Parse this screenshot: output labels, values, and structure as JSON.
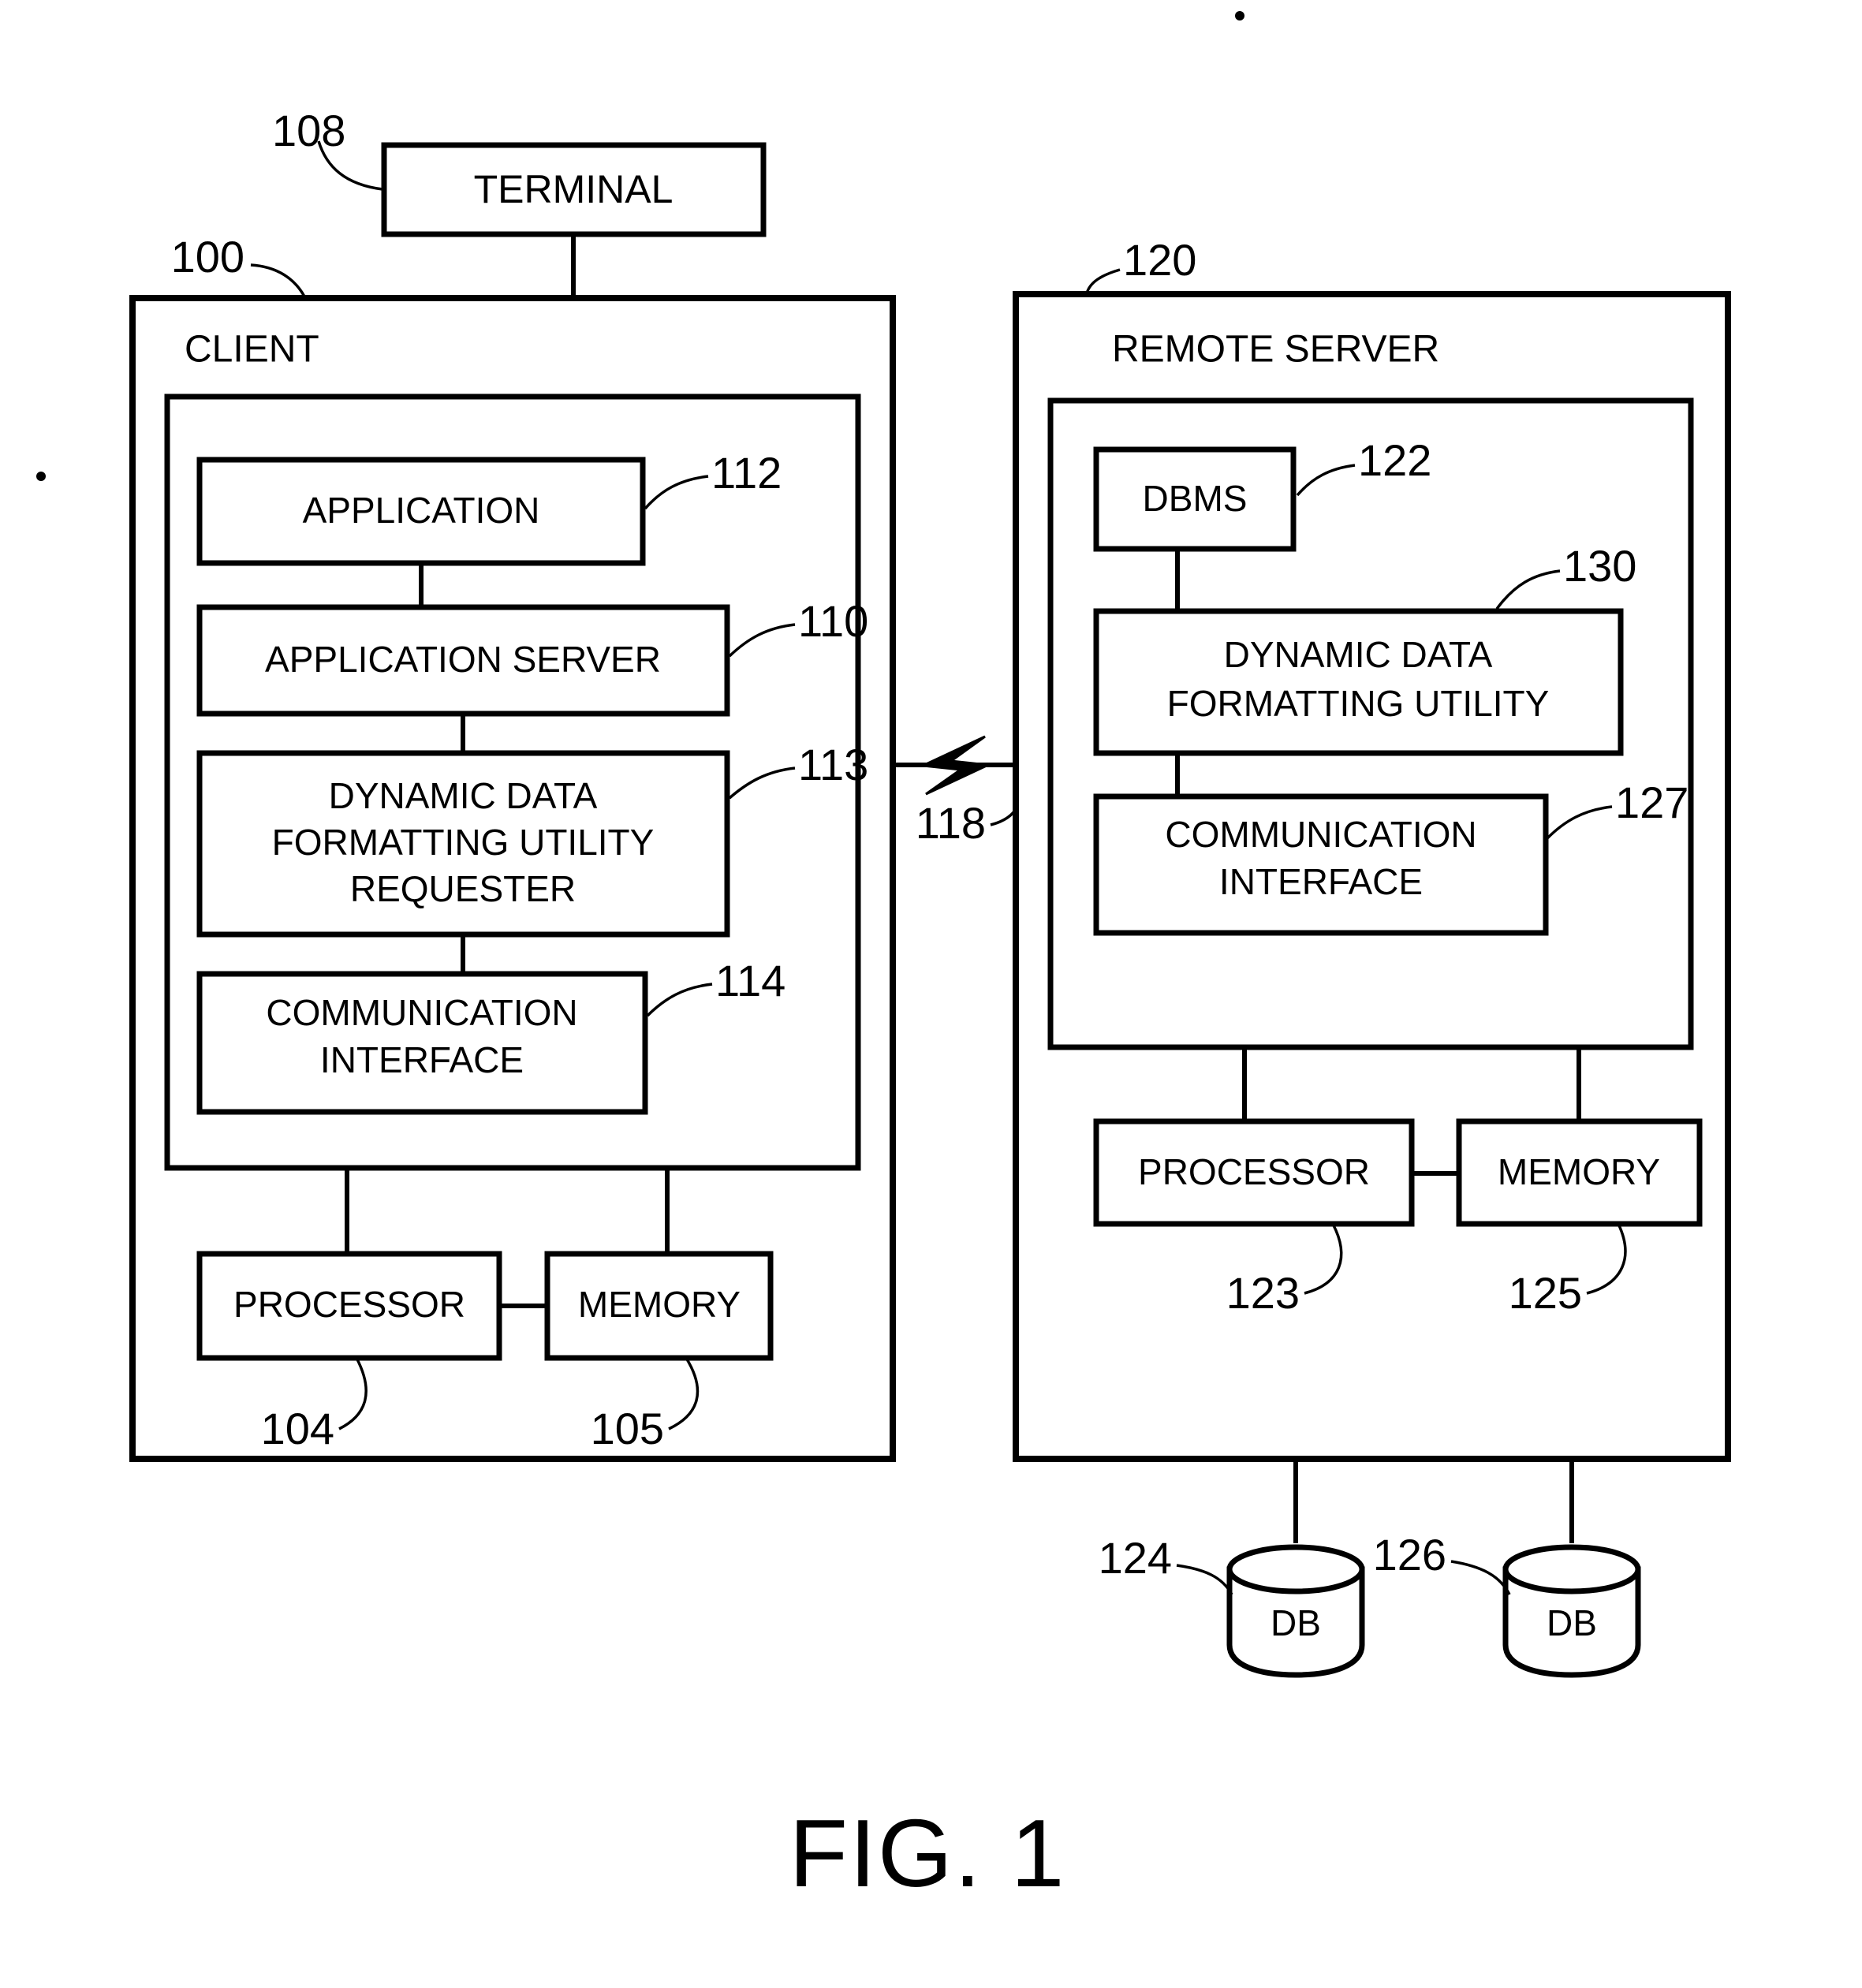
{
  "figure": {
    "caption": "FIG. 1",
    "terminal": {
      "label": "TERMINAL",
      "ref": "108"
    },
    "client": {
      "label": "CLIENT",
      "ref": "100",
      "components": [
        {
          "label": "APPLICATION",
          "ref": "112"
        },
        {
          "label": "APPLICATION SERVER",
          "ref": "110"
        },
        {
          "label": "DYNAMIC DATA FORMATTING UTILITY REQUESTER",
          "line1": "DYNAMIC DATA",
          "line2": "FORMATTING UTILITY",
          "line3": "REQUESTER",
          "ref": "113"
        },
        {
          "label": "COMMUNICATION INTERFACE",
          "line1": "COMMUNICATION",
          "line2": "INTERFACE",
          "ref": "114"
        }
      ],
      "hardware": [
        {
          "label": "PROCESSOR",
          "ref": "104"
        },
        {
          "label": "MEMORY",
          "ref": "105"
        }
      ]
    },
    "link": {
      "ref": "118",
      "icon": "lightning-bolt-icon"
    },
    "server": {
      "label": "REMOTE SERVER",
      "ref": "120",
      "components": [
        {
          "label": "DBMS",
          "ref": "122"
        },
        {
          "label": "DYNAMIC DATA FORMATTING UTILITY",
          "line1": "DYNAMIC DATA",
          "line2": "FORMATTING UTILITY",
          "ref": "130"
        },
        {
          "label": "COMMUNICATION INTERFACE",
          "line1": "COMMUNICATION",
          "line2": "INTERFACE",
          "ref": "127"
        }
      ],
      "hardware": [
        {
          "label": "PROCESSOR",
          "ref": "123"
        },
        {
          "label": "MEMORY",
          "ref": "125"
        }
      ],
      "databases": [
        {
          "label": "DB",
          "ref": "124"
        },
        {
          "label": "DB",
          "ref": "126"
        }
      ]
    }
  }
}
